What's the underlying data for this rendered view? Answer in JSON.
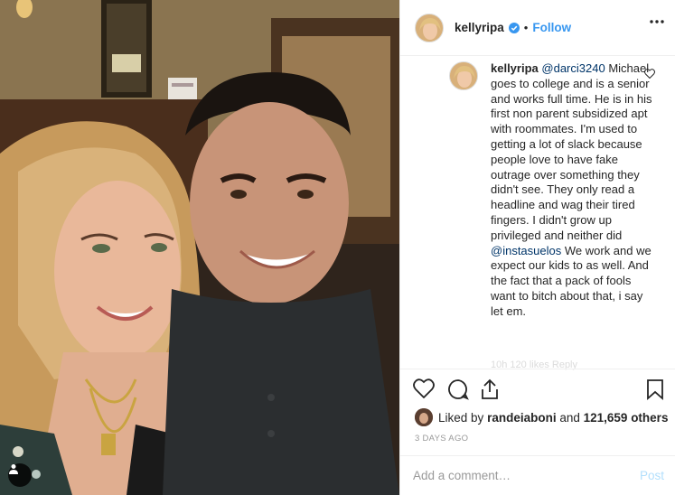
{
  "post": {
    "username": "kellyripa",
    "follow_label": "Follow",
    "separator": "•"
  },
  "comment": {
    "username": "kellyripa",
    "mention": "@darci3240",
    "text_part1": "Michael goes to college and is a senior and works full time. He is in his first non parent subsidized apt with roommates. I'm used to getting a lot of slack because people love to have fake outrage over something they didn't see. They only read a headline and wag their tired fingers. I didn't grow up privileged and neither did",
    "mention2": "@instasuelos",
    "text_part2": "We work and we expect our kids to as well. And the fact that a pack of fools want to bitch about that, i say let em.",
    "meta_faded": "10h    120 likes    Reply"
  },
  "likes": {
    "prefix": "Liked by",
    "liker": "randeiaboni",
    "middle": "and",
    "count": "121,659 others"
  },
  "timestamp": "3 DAYS AGO",
  "add_comment": {
    "placeholder": "Add a comment…",
    "post_label": "Post"
  },
  "icons": {
    "verified": "verified-badge-icon",
    "more": "more-options-icon",
    "heart": "heart-icon",
    "comment": "comment-icon",
    "share": "share-icon",
    "save": "bookmark-icon",
    "tag": "user-tag-icon"
  },
  "colors": {
    "accent": "#3897f0",
    "post_disabled": "#b2dffc",
    "mention": "#003569"
  }
}
